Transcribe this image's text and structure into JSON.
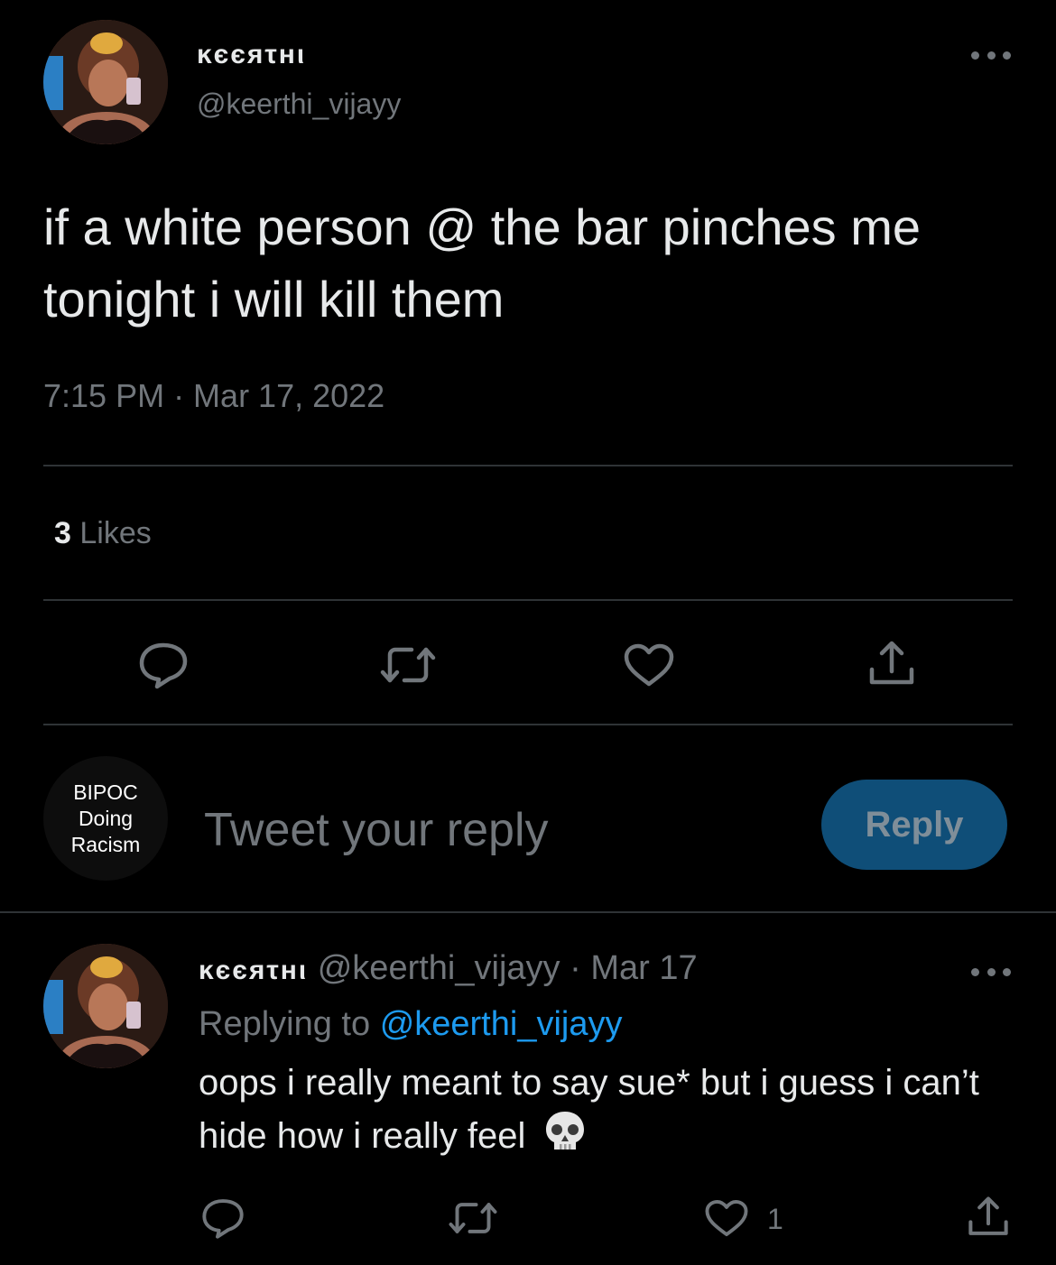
{
  "main_tweet": {
    "display_name": "ĸєєяτнι",
    "handle": "@keerthi_vijayy",
    "text": "if a white person @ the bar pinches me tonight i will kill them",
    "meta": "7:15 PM · Mar 17, 2022",
    "likes_count": "3",
    "likes_label": "Likes"
  },
  "composer": {
    "avatar_lines": [
      "BIPOC",
      "Doing",
      "Racism"
    ],
    "placeholder": "Tweet your reply",
    "button_label": "Reply"
  },
  "reply_tweet": {
    "display_name": "ĸєєяτнι",
    "handle": "@keerthi_vijayy",
    "separator": "·",
    "date": "Mar 17",
    "replying_prefix": "Replying to",
    "replying_handle": "@keerthi_vijayy",
    "text": "oops i really meant to say sue* but i guess i can’t hide how i really feel",
    "emoji": "skull-emoji",
    "like_count": "1"
  },
  "icons": {
    "reply": "reply-icon",
    "retweet": "retweet-icon",
    "like": "heart-icon",
    "share": "share-icon",
    "more": "more-icon"
  },
  "colors": {
    "background": "#000000",
    "text": "#e7e9ea",
    "secondary": "#71767b",
    "accent": "#1d9bf0",
    "reply_button_bg": "#0f4e78",
    "divider": "#2f3336"
  }
}
